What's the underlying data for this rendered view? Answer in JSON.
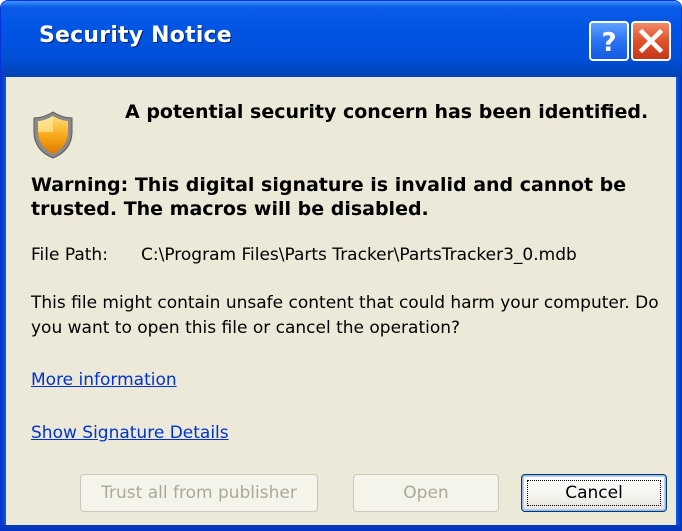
{
  "window": {
    "title": "Security Notice",
    "help_glyph": "?",
    "close_glyph": "✕"
  },
  "icon": "security-shield-icon",
  "headline": "A potential security concern has been identified.",
  "warning": "Warning: This digital signature is invalid and cannot be trusted. The macros will be disabled.",
  "file_path": {
    "label": "File Path:",
    "value": "C:\\Program Files\\Parts Tracker\\PartsTracker3_0.mdb"
  },
  "description": "This file might contain unsafe content that could harm your computer. Do you want to open this file or cancel the operation?",
  "links": {
    "more_info": "More information",
    "signature_details": "Show Signature Details"
  },
  "buttons": {
    "trust": "Trust all from publisher",
    "open": "Open",
    "cancel": "Cancel"
  },
  "colors": {
    "titlebar": "#0054e3",
    "dialog_bg": "#ece9d8",
    "link": "#0033cc",
    "close_button": "#e0522a"
  }
}
